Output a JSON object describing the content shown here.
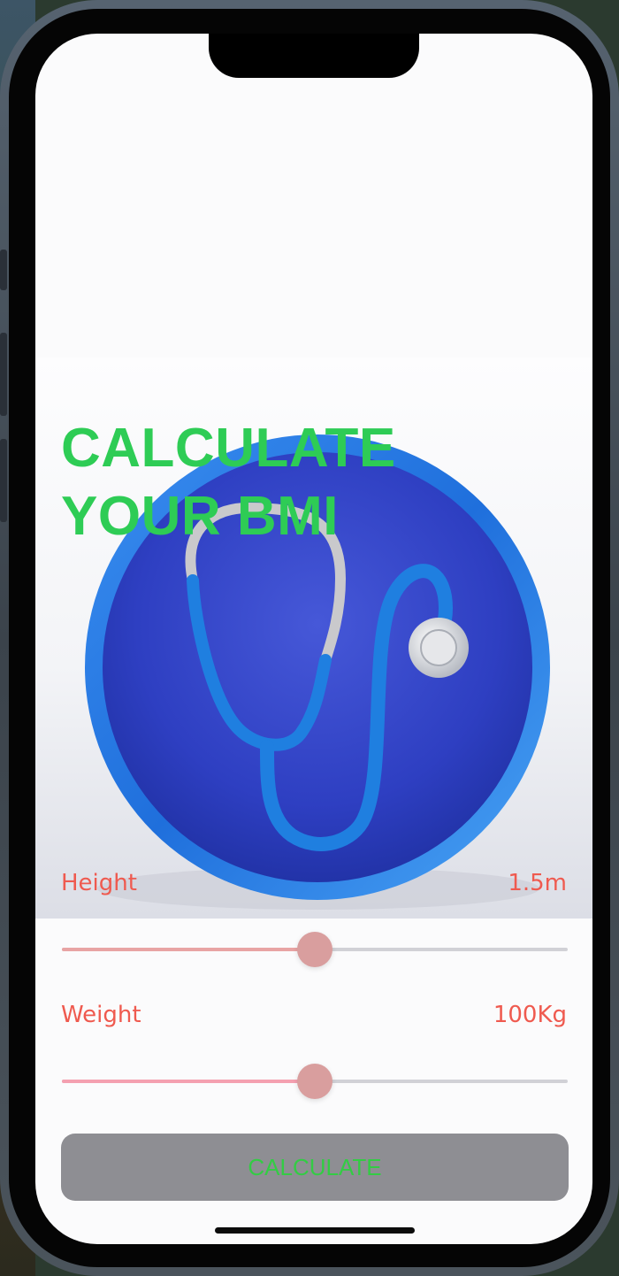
{
  "app": {
    "title_line1": "CALCULATE",
    "title_line2": "YOUR BMI"
  },
  "height": {
    "label": "Height",
    "value": "1.5m",
    "slider_fraction": 0.5,
    "fill_color": "#e8a4a4"
  },
  "weight": {
    "label": "Weight",
    "value": "100Kg",
    "slider_fraction": 0.5,
    "fill_color": "#f4a0b0"
  },
  "calculate_button": {
    "label": "CALCULATE"
  },
  "colors": {
    "title": "#2ecc55",
    "labels": "#ef5a4f",
    "button_bg": "#8e8e93",
    "button_text": "#33cc44",
    "thumb": "#d99e9e"
  },
  "icons": {
    "hero": "stethoscope-icon"
  }
}
